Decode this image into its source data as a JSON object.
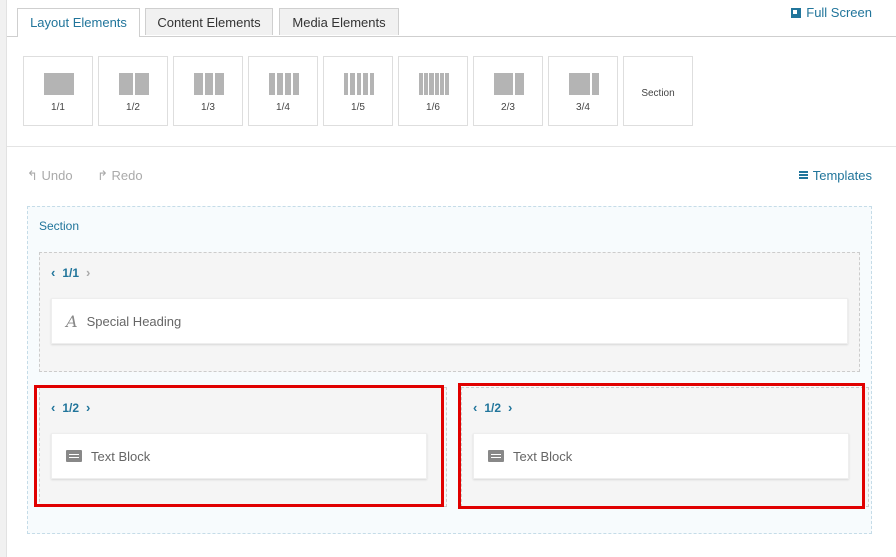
{
  "tabs": [
    {
      "label": "Layout Elements",
      "active": true
    },
    {
      "label": "Content Elements",
      "active": false
    },
    {
      "label": "Media Elements",
      "active": false
    }
  ],
  "fullscreen_label": "Full Screen",
  "layout_buttons": [
    {
      "label": "1/1",
      "icon": "col-1-1-icon"
    },
    {
      "label": "1/2",
      "icon": "col-1-2-icon"
    },
    {
      "label": "1/3",
      "icon": "col-1-3-icon"
    },
    {
      "label": "1/4",
      "icon": "col-1-4-icon"
    },
    {
      "label": "1/5",
      "icon": "col-1-5-icon"
    },
    {
      "label": "1/6",
      "icon": "col-1-6-icon"
    },
    {
      "label": "2/3",
      "icon": "col-2-3-icon"
    },
    {
      "label": "3/4",
      "icon": "col-3-4-icon"
    },
    {
      "label": "Section",
      "icon": "section-icon"
    }
  ],
  "toolbar": {
    "undo": "Undo",
    "redo": "Redo",
    "templates": "Templates"
  },
  "section": {
    "label": "Section",
    "full_column": {
      "size": "1/1",
      "element": "Special Heading"
    },
    "half_columns": [
      {
        "size": "1/2",
        "element": "Text Block"
      },
      {
        "size": "1/2",
        "element": "Text Block"
      }
    ]
  },
  "colors": {
    "accent": "#21759b",
    "highlight": "#e00000"
  }
}
